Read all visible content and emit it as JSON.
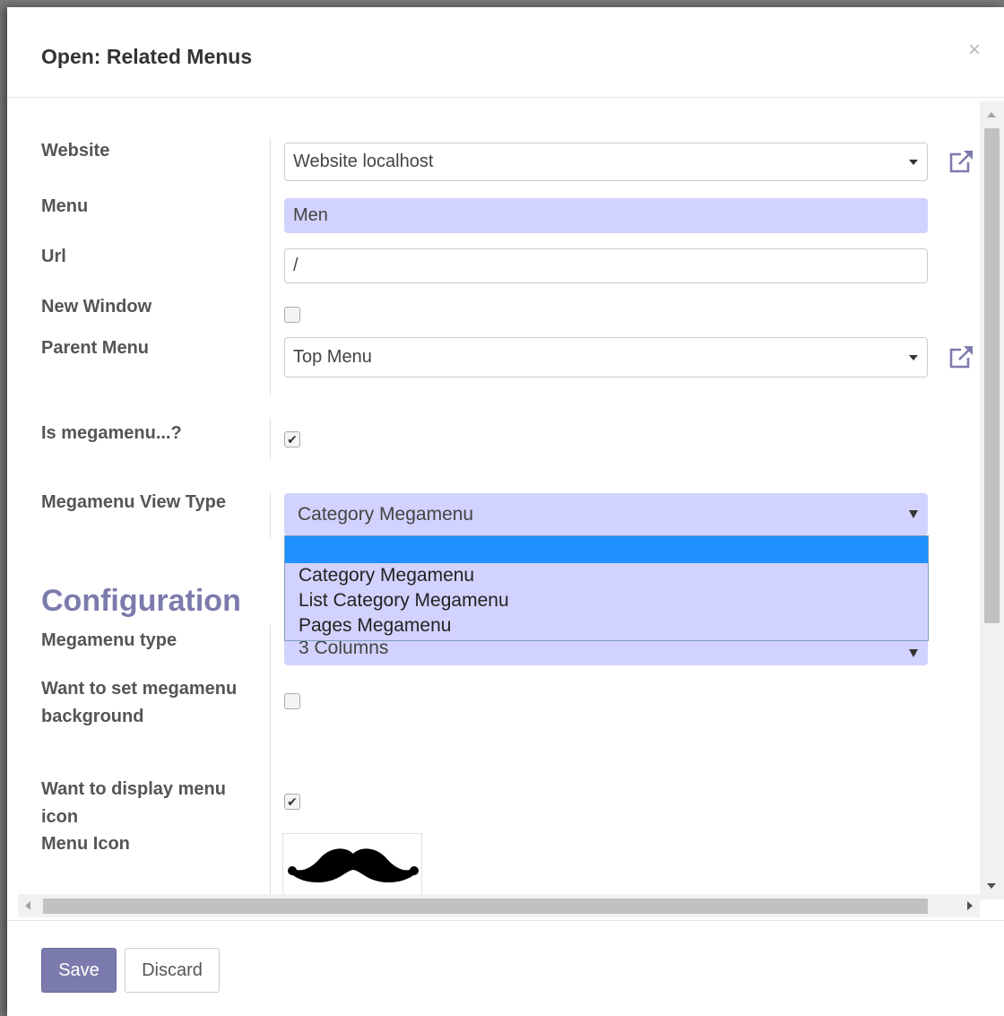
{
  "dialog": {
    "title": "Open: Related Menus",
    "close_symbol": "×"
  },
  "form": {
    "website": {
      "label": "Website",
      "value": "Website localhost"
    },
    "menu": {
      "label": "Menu",
      "value": "Men"
    },
    "url": {
      "label": "Url",
      "value": "/"
    },
    "new_window": {
      "label": "New Window",
      "checked": false
    },
    "parent_menu": {
      "label": "Parent Menu",
      "value": "Top Menu"
    },
    "is_megamenu": {
      "label": "Is megamenu...?",
      "checked": true
    },
    "megamenu_view_type": {
      "label": "Megamenu View Type",
      "value": "Category Megamenu",
      "options": [
        "",
        "Category Megamenu",
        "List Category Megamenu",
        "Pages Megamenu"
      ]
    },
    "configuration_title": "Configuration",
    "megamenu_type": {
      "label": "Megamenu type",
      "value": "3 Columns"
    },
    "set_background": {
      "label": "Want to set megamenu background",
      "checked": false
    },
    "display_icon": {
      "label": "Want to display menu icon",
      "checked": true
    },
    "menu_icon": {
      "label": "Menu Icon",
      "icon": "mustache-icon"
    }
  },
  "footer": {
    "save_label": "Save",
    "discard_label": "Discard"
  },
  "colors": {
    "primary": "#7c7bad",
    "required_field": "#d2d2ff",
    "dropdown_highlight": "#1e90ff"
  },
  "icons": {
    "external_link": "external-link-icon",
    "check": "✔"
  }
}
